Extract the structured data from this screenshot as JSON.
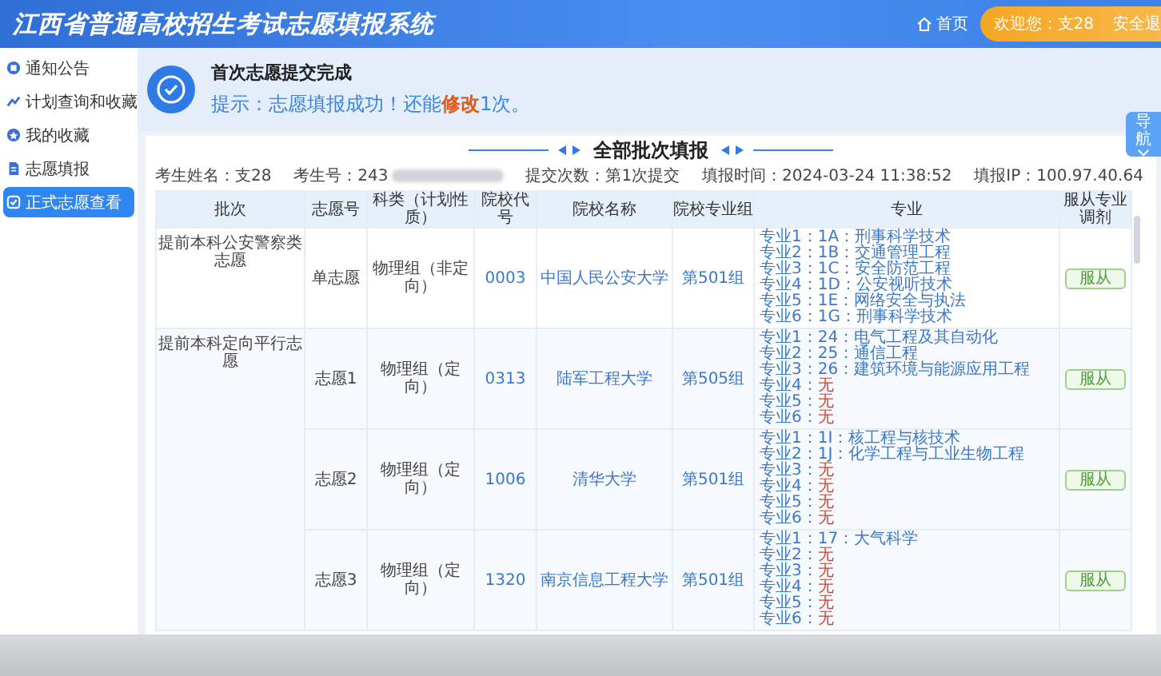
{
  "header": {
    "title": "江西省普通高校招生考试志愿填报系统",
    "home": "首页",
    "welcome": "欢迎您：支28",
    "logout": "安全退"
  },
  "sidebar": {
    "items": [
      {
        "label": "通知公告",
        "selected": false
      },
      {
        "label": "计划查询和收藏",
        "selected": false
      },
      {
        "label": "我的收藏",
        "selected": false
      },
      {
        "label": "志愿填报",
        "selected": false
      },
      {
        "label": "正式志愿查看",
        "selected": true
      }
    ]
  },
  "banner": {
    "title": "首次志愿提交完成",
    "message": "提示：志愿填报成功！还能**修改**1次。"
  },
  "nav_tab": "导航",
  "section_title": "全部批次填报",
  "info": [
    {
      "label": "考生姓名：",
      "value": "支28",
      "redacted": false
    },
    {
      "label": "考生号：",
      "value": "243",
      "redacted": true
    },
    {
      "label": "提交次数：",
      "value": "第1次提交",
      "redacted": false
    },
    {
      "label": "填报时间：",
      "value": "2024-03-24 11:38:52",
      "redacted": false
    },
    {
      "label": "填报IP：",
      "value": "100.97.40.64",
      "redacted": false
    }
  ],
  "table": {
    "columns": [
      "批次",
      "志愿号",
      "科类（计划性质）",
      "院校代号",
      "院校名称",
      "院校专业组",
      "专业",
      "服从专业调剂"
    ],
    "groups": [
      {
        "batch": "提前本科公安警察类志愿",
        "choices": [
          {
            "choice": "单志愿",
            "category": "物理组（非定向）",
            "code": "0003",
            "school": "中国人民公安大学",
            "group": "第501组",
            "adjust": "服从",
            "majors": [
              {
                "kind": "major",
                "label": "专业1：",
                "value": "1A：刑事科学技术"
              },
              {
                "kind": "major",
                "label": "专业2：",
                "value": "1B：交通管理工程"
              },
              {
                "kind": "major",
                "label": "专业3：",
                "value": "1C：安全防范工程"
              },
              {
                "kind": "major",
                "label": "专业4：",
                "value": "1D：公安视听技术"
              },
              {
                "kind": "major",
                "label": "专业5：",
                "value": "1E：网络安全与执法"
              },
              {
                "kind": "major",
                "label": "专业6：",
                "value": "1G：刑事科学技术"
              }
            ]
          }
        ]
      },
      {
        "batch": "提前本科定向平行志愿",
        "choices": [
          {
            "choice": "志愿1",
            "category": "物理组（定向）",
            "code": "0313",
            "school": "陆军工程大学",
            "group": "第505组",
            "adjust": "服从",
            "majors": [
              {
                "kind": "major",
                "label": "专业1：",
                "value": "24：电气工程及其自动化"
              },
              {
                "kind": "major",
                "label": "专业2：",
                "value": "25：通信工程"
              },
              {
                "kind": "major",
                "label": "专业3：",
                "value": "26：建筑环境与能源应用工程"
              },
              {
                "kind": "none",
                "label": "专业4：",
                "value": "无"
              },
              {
                "kind": "none",
                "label": "专业5：",
                "value": "无"
              },
              {
                "kind": "none",
                "label": "专业6：",
                "value": "无"
              }
            ]
          },
          {
            "choice": "志愿2",
            "category": "物理组（定向）",
            "code": "1006",
            "school": "清华大学",
            "group": "第501组",
            "adjust": "服从",
            "majors": [
              {
                "kind": "major",
                "label": "专业1：",
                "value": "1I：核工程与核技术"
              },
              {
                "kind": "major",
                "label": "专业2：",
                "value": "1J：化学工程与工业生物工程"
              },
              {
                "kind": "none",
                "label": "专业3：",
                "value": "无"
              },
              {
                "kind": "none",
                "label": "专业4：",
                "value": "无"
              },
              {
                "kind": "none",
                "label": "专业5：",
                "value": "无"
              },
              {
                "kind": "none",
                "label": "专业6：",
                "value": "无"
              }
            ]
          },
          {
            "choice": "志愿3",
            "category": "物理组（定向）",
            "code": "1320",
            "school": "南京信息工程大学",
            "group": "第501组",
            "adjust": "服从",
            "majors": [
              {
                "kind": "major",
                "label": "专业1：",
                "value": "17：大气科学"
              },
              {
                "kind": "none",
                "label": "专业2：",
                "value": "无"
              },
              {
                "kind": "none",
                "label": "专业3：",
                "value": "无"
              },
              {
                "kind": "none",
                "label": "专业4：",
                "value": "无"
              },
              {
                "kind": "none",
                "label": "专业5：",
                "value": "无"
              },
              {
                "kind": "none",
                "label": "专业6：",
                "value": "无"
              }
            ]
          }
        ]
      }
    ]
  }
}
